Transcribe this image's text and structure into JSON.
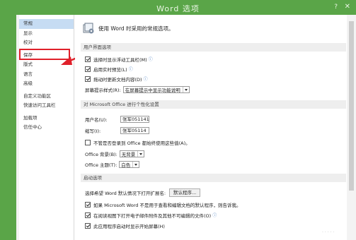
{
  "window": {
    "title": "Word 选项",
    "help_glyph": "?",
    "close_glyph": "✕"
  },
  "sidebar": {
    "items": [
      {
        "label": "常规",
        "selected": true
      },
      {
        "label": "显示"
      },
      {
        "label": "校对"
      },
      {
        "label": "保存",
        "highlighted": true
      },
      {
        "label": "版式"
      },
      {
        "label": "语言"
      },
      {
        "label": "高级"
      },
      {
        "label": "自定义功能区"
      },
      {
        "label": "快速访问工具栏"
      },
      {
        "label": "加载项"
      },
      {
        "label": "信任中心"
      }
    ]
  },
  "main": {
    "header": "使用 Word 时采用的常规选项。",
    "ui_section": {
      "title": "用户界面选项",
      "opt_minitoolbar": "选择时显示浮动工具栏(M)",
      "opt_livepreview": "启用实时预览(L)",
      "opt_dragupdate": "拖动时更新文档内容(D)",
      "tip_label": "屏幕提示样式(R):",
      "tip_value": "在屏幕提示中显示功能说明"
    },
    "personal_section": {
      "title": "对 Microsoft Office 进行个性化设置",
      "username_label": "用户名(U):",
      "username_value": "张军051141",
      "initials_label": "缩写(I):",
      "initials_value": "张军05114",
      "always_use": "不管是否登录到 Office 都始终使用这些值(A)。",
      "bg_label": "Office 背景(B):",
      "bg_value": "无背景",
      "theme_label": "Office 主题(T):",
      "theme_value": "白色"
    },
    "startup_section": {
      "title": "启动选项",
      "ext_label": "选择希望 Word 默认情况下打开扩展名:",
      "ext_button": "默认程序...",
      "opt_default_viewer": "如果 Microsoft Word 不是用于查看和编辑文档的默认程序，则告诉我。",
      "opt_reading_view": "在阅读视图下打开电子邮件附件及其他不可编辑的文件(O)",
      "opt_start_screen": "此应用程序启动时显示开始屏幕(H)"
    }
  },
  "colors": {
    "titlebar": "#5aa548",
    "selected": "#c6dcf3",
    "highlight": "#e0202a"
  },
  "watermark": "· · · · ·"
}
